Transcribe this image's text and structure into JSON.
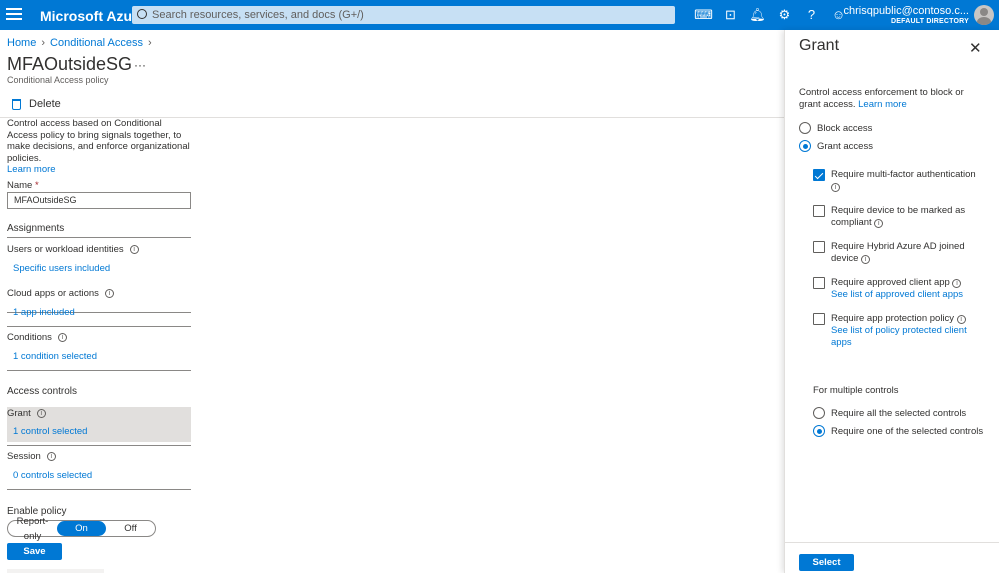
{
  "topbar": {
    "brand": "Microsoft Azure",
    "search_placeholder": "Search resources, services, and docs (G+/)",
    "account_email": "chrisqpublic@contoso.c...",
    "account_directory": "DEFAULT DIRECTORY",
    "icons": [
      "cloud-shell-icon",
      "directory-filter-icon",
      "notifications-icon",
      "settings-icon",
      "help-icon",
      "feedback-icon"
    ]
  },
  "breadcrumb": {
    "home": "Home",
    "conditional_access": "Conditional Access"
  },
  "page": {
    "title": "MFAOutsideSG",
    "more": "···",
    "subtitle": "Conditional Access policy",
    "delete_label": "Delete",
    "intro": "Control access based on Conditional Access policy to bring signals together, to make decisions, and enforce organizational policies.",
    "learn_more": "Learn more"
  },
  "form": {
    "name_label": "Name",
    "name_required": "*",
    "name_value": "MFAOutsideSG",
    "assignments_heading": "Assignments",
    "users_label": "Users or workload identities",
    "users_value": "Specific users included",
    "cloud_apps_label": "Cloud apps or actions",
    "cloud_apps_value": "1 app included",
    "conditions_label": "Conditions",
    "conditions_value": "1 condition selected",
    "access_controls_heading": "Access controls",
    "grant_label": "Grant",
    "grant_value": "1 control selected",
    "session_label": "Session",
    "session_value": "0 controls selected",
    "enable_policy_label": "Enable policy",
    "toggle": {
      "report_only": "Report-only",
      "on": "On",
      "off": "Off"
    },
    "save_label": "Save"
  },
  "panel": {
    "title": "Grant",
    "close": "✕",
    "description": "Control access enforcement to block or grant access.",
    "learn_more": "Learn more",
    "block_access": "Block access",
    "grant_access": "Grant access",
    "controls": [
      {
        "label": "Require multi-factor authentication",
        "checked": true
      },
      {
        "label": "Require device to be marked as compliant",
        "checked": false
      },
      {
        "label": "Require Hybrid Azure AD joined device",
        "checked": false
      },
      {
        "label": "Require approved client app",
        "link": "See list of approved client apps",
        "checked": false
      },
      {
        "label": "Require app protection policy",
        "link": "See list of policy protected client apps",
        "checked": false
      }
    ],
    "multiple_controls_label": "For multiple controls",
    "require_all": "Require all the selected controls",
    "require_one": "Require one of the selected controls",
    "select_label": "Select"
  }
}
